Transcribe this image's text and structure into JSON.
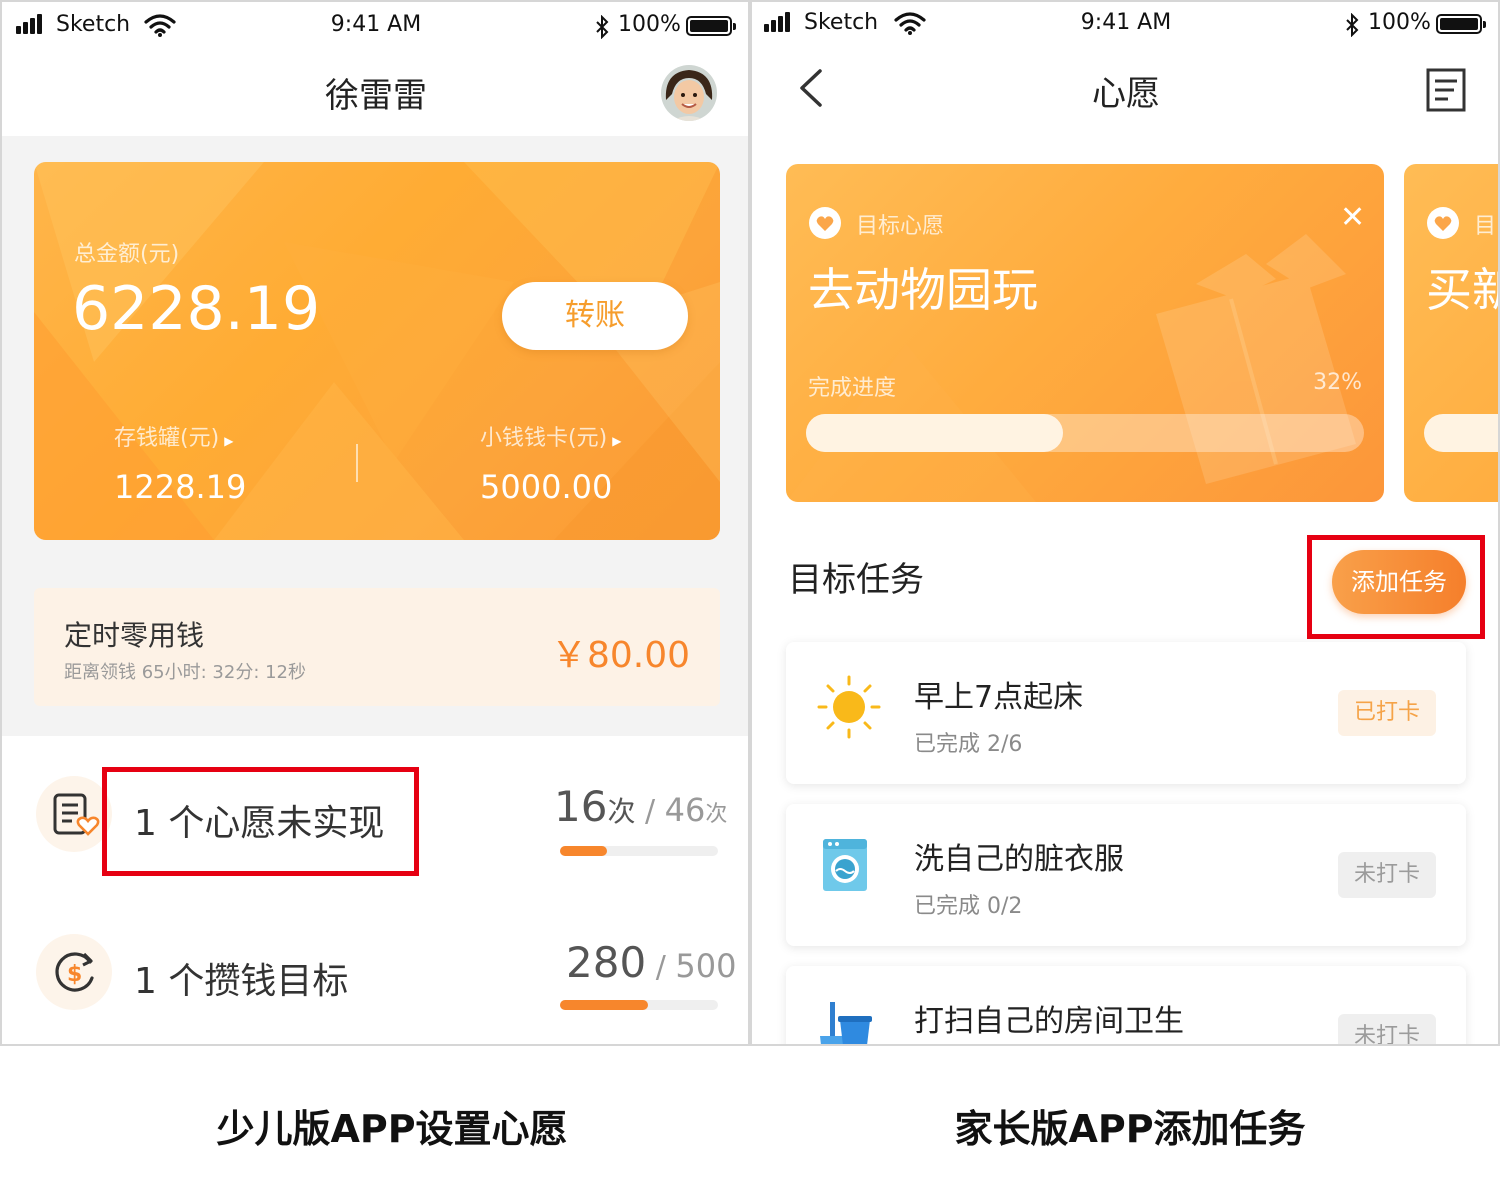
{
  "status_bar": {
    "carrier": "Sketch",
    "time": "9:41 AM",
    "battery": "100%"
  },
  "left": {
    "nav_title": "徐雷雷",
    "balance_card": {
      "total_label": "总金额(元)",
      "total_value": "6228.19",
      "transfer_button": "转账",
      "piggy_label": "存钱罐(元)",
      "piggy_value": "1228.19",
      "wallet_label": "小钱钱卡(元)",
      "wallet_value": "5000.00"
    },
    "pocket_money": {
      "title": "定时零用钱",
      "countdown": "距离领钱 65小时: 32分: 12秒",
      "amount": "￥80.00"
    },
    "wish_row": {
      "label": "1 个心愿未实现",
      "count_main": "16",
      "count_main_unit": "次",
      "count_sep": " / ",
      "count_total": "46",
      "count_total_unit": "次",
      "progress": 0.3
    },
    "saving_row": {
      "label": "1 个攒钱目标",
      "value_main": "280",
      "value_sep": " / ",
      "value_total": "500",
      "progress": 0.56
    }
  },
  "right": {
    "nav_title": "心愿",
    "wish_card": {
      "tag": "目标心愿",
      "title": "去动物园玩",
      "progress_label": "完成进度",
      "progress_text": "32%",
      "progress": 0.46
    },
    "next_card": {
      "tag": "目",
      "title": "买新"
    },
    "section_title": "目标任务",
    "add_button": "添加任务",
    "tasks": [
      {
        "title": "早上7点起床",
        "sub": "已完成 2/6",
        "badge": "已打卡",
        "icon": "sun-icon"
      },
      {
        "title": "洗自己的脏衣服",
        "sub": "已完成 0/2",
        "badge": "未打卡",
        "icon": "washing-machine-icon"
      },
      {
        "title": "打扫自己的房间卫生",
        "sub": "",
        "badge": "未打卡",
        "icon": "broom-bucket-icon"
      }
    ]
  },
  "captions": {
    "left": "少儿版APP设置心愿",
    "right": "家长版APP添加任务"
  },
  "colors": {
    "orange": "#f7862c",
    "highlight_red": "#e60012",
    "card_orange": "#ffac34"
  }
}
